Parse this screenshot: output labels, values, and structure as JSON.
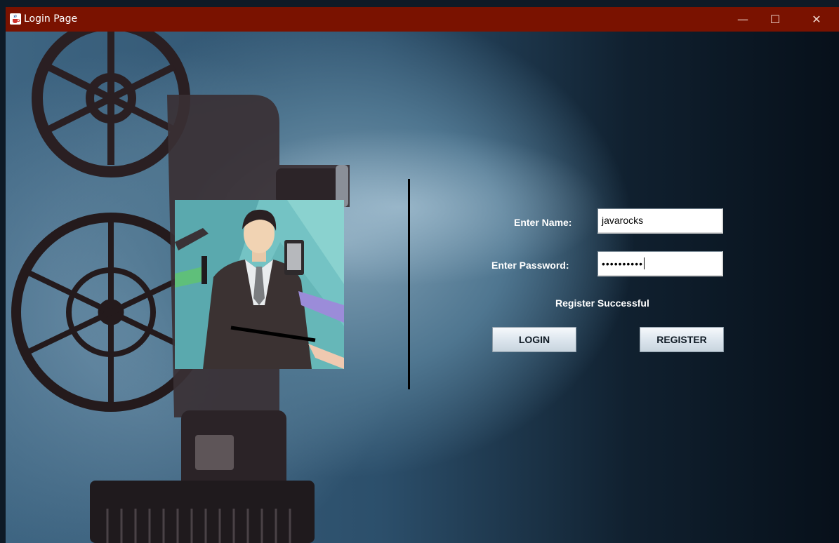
{
  "window": {
    "title": "Login Page",
    "controls": {
      "minimize": "—",
      "maximize": "☐",
      "close": "✕"
    }
  },
  "form": {
    "name_label": "Enter Name:",
    "name_value": "javarocks",
    "password_label": "Enter Password:",
    "password_value": "••••••••••",
    "status_message": "Register Successful",
    "login_label": "LOGIN",
    "register_label": "REGISTER"
  },
  "colors": {
    "titlebar": "#7a1200",
    "background": "#2c4f6b",
    "button": "#dde6ee"
  },
  "images": {
    "background": "film-projector-photo",
    "portrait": "businessman-interviewed-illustration"
  }
}
